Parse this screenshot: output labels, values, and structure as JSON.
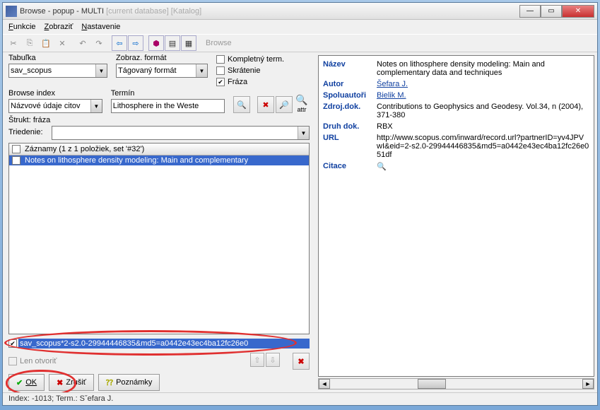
{
  "window": {
    "title": "Browse - popup - MULTI",
    "dimmed": "[current database] [Katalog]"
  },
  "menu": {
    "funkcie": "Funkcie",
    "zobrazit": "Zobraziť",
    "nastavenie": "Nastavenie"
  },
  "toolbar": {
    "browse": "Browse"
  },
  "fields": {
    "tabulka_label": "Tabuľka",
    "tabulka_value": "sav_scopus",
    "format_label": "Zobraz. formát",
    "format_value": "Tágovaný formát",
    "kompletny": "Kompletný term.",
    "skratenie": "Skrátenie",
    "fraza": "Fráza",
    "browse_index_label": "Browse index",
    "browse_index_value": "Názvové údaje citov",
    "termin_label": "Termín",
    "termin_value": "Lithosphere in the Weste",
    "strukt": "Štrukt: fráza",
    "attr": "attr",
    "triedenie_label": "Triedenie:"
  },
  "list": {
    "header": "Záznamy (1 z 1  položiek, set '#32')",
    "row1": "Notes on lithosphere density modeling: Main and complementary"
  },
  "selected_value": "sav_scopus*2-s2.0-29944446835&md5=a0442e43ec4ba12fc26e0",
  "len_otvorit": "Len otvoriť",
  "buttons": {
    "ok": "OK",
    "zrusit": "Zrušiť",
    "poznamky": "Poznámky"
  },
  "details": {
    "nazev_label": "Název",
    "nazev_value": "Notes on lithosphere density modeling: Main and complementary data and techniques",
    "autor_label": "Autor",
    "autor_value": "Šefara J.",
    "spolu_label": "Spoluautoři",
    "spolu_value": "Bielik M.",
    "zdroj_label": "Zdroj.dok.",
    "zdroj_value": "Contributions to Geophysics and Geodesy. Vol.34, n (2004), 371-380",
    "druh_label": "Druh dok.",
    "druh_value": "RBX",
    "url_label": "URL",
    "url_value": "http://www.scopus.com/inward/record.url?partnerID=yv4JPVwI&eid=2-s2.0-29944446835&md5=a0442e43ec4ba12fc26e051df",
    "citace_label": "Citace"
  },
  "status": "Index: -1013; Term.: Sˇefara J."
}
